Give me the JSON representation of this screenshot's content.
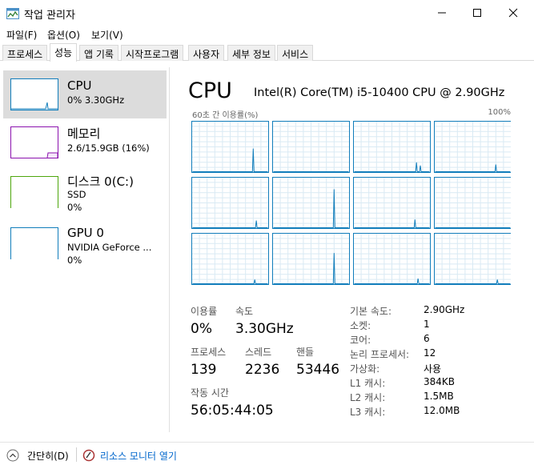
{
  "window": {
    "title": "작업 관리자"
  },
  "menu": [
    "파일(F)",
    "옵션(O)",
    "보기(V)"
  ],
  "tabs": [
    "프로세스",
    "성능",
    "앱 기록",
    "시작프로그램",
    "사용자",
    "세부 정보",
    "서비스"
  ],
  "sidebar": {
    "items": [
      {
        "title": "CPU",
        "line1": "0% 3.30GHz",
        "line2": "",
        "color": "#117dbb"
      },
      {
        "title": "메모리",
        "line1": "2.6/15.9GB (16%)",
        "line2": "",
        "color": "#8b12ae"
      },
      {
        "title": "디스크 0(C:)",
        "line1": "SSD",
        "line2": "0%",
        "color": "#4da60c"
      },
      {
        "title": "GPU 0",
        "line1": "NVIDIA GeForce ...",
        "line2": "0%",
        "color": "#117dbb"
      }
    ]
  },
  "main": {
    "title": "CPU",
    "model": "Intel(R) Core(TM) i5-10400 CPU @ 2.90GHz",
    "graph_label_left": "60초 간 이용률(%)",
    "graph_label_right": "100%",
    "stats": {
      "utilization_label": "이용률",
      "utilization_value": "0%",
      "speed_label": "속도",
      "speed_value": "3.30GHz",
      "processes_label": "프로세스",
      "processes_value": "139",
      "threads_label": "스레드",
      "threads_value": "2236",
      "handles_label": "핸들",
      "handles_value": "53446",
      "uptime_label": "작동 시간",
      "uptime_value": "56:05:44:05"
    },
    "info": [
      {
        "label": "기본 속도:",
        "value": "2.90GHz"
      },
      {
        "label": "소켓:",
        "value": "1"
      },
      {
        "label": "코어:",
        "value": "6"
      },
      {
        "label": "논리 프로세서:",
        "value": "12"
      },
      {
        "label": "가상화:",
        "value": "사용"
      },
      {
        "label": "L1 캐시:",
        "value": "384KB"
      },
      {
        "label": "L2 캐시:",
        "value": "1.5MB"
      },
      {
        "label": "L3 캐시:",
        "value": "12.0MB"
      }
    ]
  },
  "footer": {
    "simple_label": "간단히(D)",
    "resmon_label": "리소스 모니터 열기"
  },
  "colors": {
    "cpu_line": "#117dbb",
    "cpu_border": "#117dbb",
    "grid_line": "#d9eaf4",
    "memory": "#8b12ae",
    "disk": "#4da60c",
    "selected_bg": "#dcdcdc",
    "link": "#0066cc"
  }
}
